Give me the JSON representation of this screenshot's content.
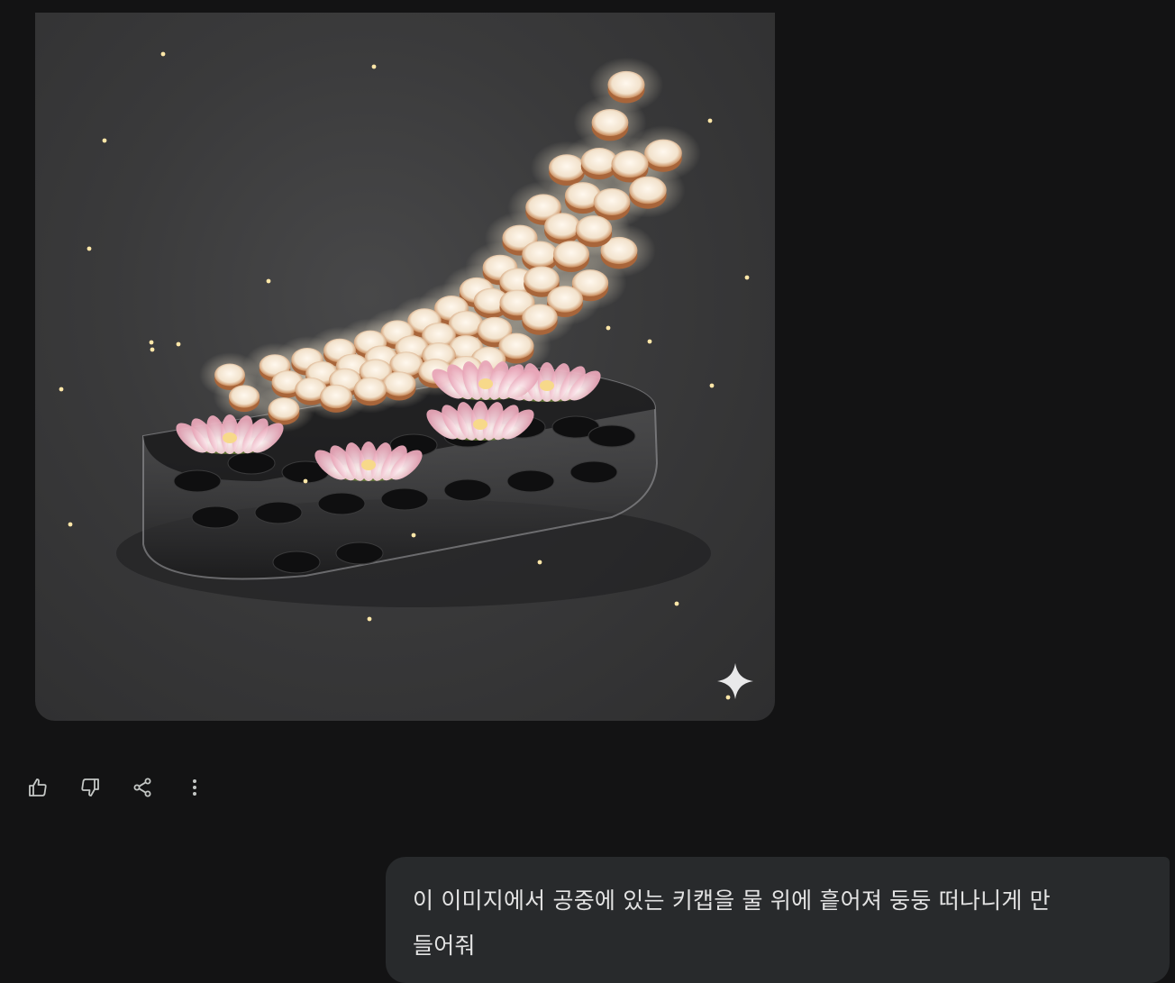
{
  "generated_image": {
    "alt_icon": "sparkle-icon",
    "content": "keycaps-floating-over-glass-water-tray-with-lotus-flowers"
  },
  "response_actions": [
    {
      "icon": "thumbs-up-icon"
    },
    {
      "icon": "thumbs-down-icon"
    },
    {
      "icon": "share-icon"
    },
    {
      "icon": "more-vertical-icon"
    }
  ],
  "user_message": {
    "text": "이 이미지에서 공중에 있는 키캡을 물 위에 흩어져 둥둥 떠나니게 만들어줘",
    "line1": "이 이미지에서 공중에 있는 키캡을 물 위에 흩어져 둥둥 떠나니게 만",
    "line2": "들어줘"
  },
  "colors": {
    "background": "#131314",
    "bubble": "#282a2c",
    "text": "#e3e3e3",
    "icon": "#c4c7c5"
  }
}
